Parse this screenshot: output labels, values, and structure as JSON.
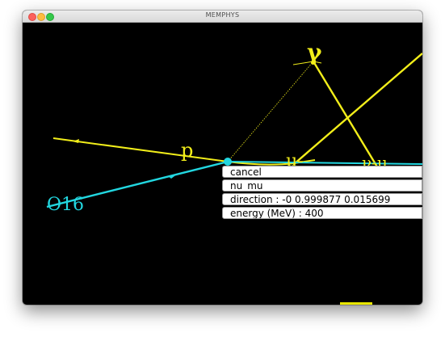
{
  "window": {
    "title": "MEMPHYS"
  },
  "scene": {
    "labels": {
      "gamma": "γ",
      "proton": "p",
      "muon": "μ-",
      "nu": "ν-μ",
      "oxygen": "O16"
    },
    "colors": {
      "yellow": "#f2ee1a",
      "cyan": "#22d7e0",
      "background": "#000000"
    }
  },
  "popup": {
    "items": [
      {
        "label": "cancel"
      },
      {
        "label": "nu_mu"
      },
      {
        "label": "direction : -0 0.999877 0.015699"
      },
      {
        "label": "energy (MeV) : 400"
      }
    ]
  }
}
